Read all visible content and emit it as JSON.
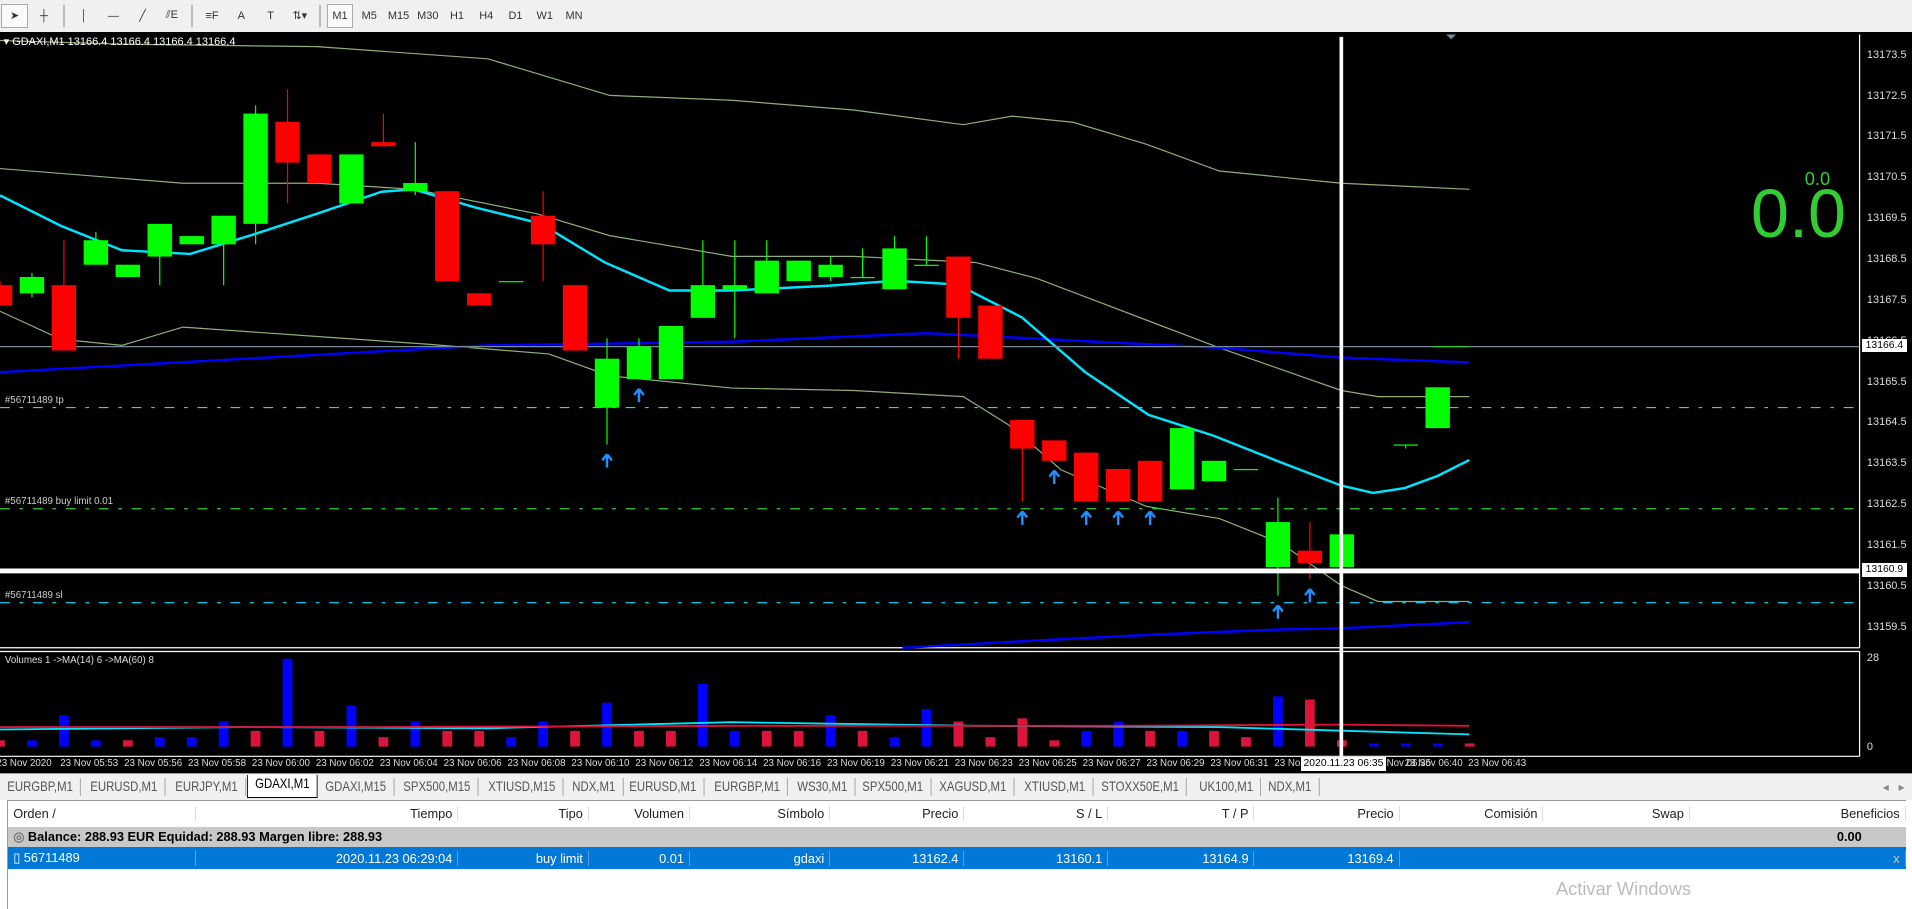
{
  "toolbar": {
    "tools": [
      "cursor",
      "crosshair",
      "vertical-line",
      "horizontal-line",
      "trendline",
      "equidistant-channel",
      "fibonacci",
      "text",
      "text-label",
      "arrows"
    ],
    "tool_glyphs": {
      "cursor": "➤",
      "crosshair": "┼",
      "vertical-line": "│",
      "horizontal-line": "—",
      "trendline": "╱",
      "equidistant-channel": "⫽E",
      "fibonacci": "≡F",
      "text": "A",
      "text-label": "T",
      "arrows": "⇅▾"
    },
    "periods": [
      "M1",
      "M5",
      "M15",
      "M30",
      "H1",
      "H4",
      "D1",
      "W1",
      "MN"
    ],
    "active_period": "M1"
  },
  "chart": {
    "header": "GDAXI,M1  13166.4 13166.4 13166.4 13166.4",
    "price_ticks": [
      "13173.5",
      "13172.5",
      "13171.5",
      "13170.5",
      "13169.5",
      "13168.5",
      "13167.5",
      "13166.5",
      "13165.5",
      "13164.5",
      "13163.5",
      "13162.5",
      "13161.5",
      "13160.5",
      "13159.5"
    ],
    "bid_label": "13166.4",
    "crosshair_price": "13160.9",
    "crosshair_time": "2020.11.23 06:35",
    "profit_small": "0.0",
    "profit_big": "0.0",
    "order_lines": {
      "tp": "#56711489 tp",
      "entry": "#56711489 buy limit 0.01",
      "sl": "#56711489 sl"
    },
    "order_prices": {
      "tp": 13164.9,
      "entry": 13162.4,
      "sl": 13160.1
    },
    "colors": {
      "up": "#00ff00",
      "down": "#ff0000",
      "ma": "#00e5ff",
      "vol_up": "#0000ff",
      "vol_down": "#dc143c"
    },
    "candles": [
      [
        13167.9,
        13168.0,
        13167.4,
        13167.4
      ],
      [
        13167.7,
        13168.2,
        13167.6,
        13168.1
      ],
      [
        13167.9,
        13169.0,
        13166.3,
        13166.3
      ],
      [
        13168.4,
        13169.2,
        13168.4,
        13169.0
      ],
      [
        13168.1,
        13168.4,
        13168.1,
        13168.4
      ],
      [
        13168.6,
        13169.4,
        13167.9,
        13169.4
      ],
      [
        13168.9,
        13169.1,
        13168.9,
        13169.1
      ],
      [
        13168.9,
        13169.6,
        13167.9,
        13169.6
      ],
      [
        13169.4,
        13172.3,
        13168.9,
        13172.1
      ],
      [
        13171.9,
        13172.7,
        13169.9,
        13170.9
      ],
      [
        13171.1,
        13171.1,
        13170.4,
        13170.4
      ],
      [
        13169.9,
        13171.1,
        13169.9,
        13171.1
      ],
      [
        13171.4,
        13172.1,
        13171.3,
        13171.3
      ],
      [
        13170.2,
        13171.4,
        13170.1,
        13170.4
      ],
      [
        13170.2,
        13170.2,
        13168.0,
        13168.0
      ],
      [
        13167.7,
        13167.7,
        13167.4,
        13167.4
      ],
      [
        13168.0,
        13168.0,
        13168.0,
        13168.0
      ],
      [
        13169.6,
        13170.2,
        13168.0,
        13168.9
      ],
      [
        13167.9,
        13167.9,
        13166.3,
        13166.3
      ],
      [
        13164.9,
        13166.6,
        13164.0,
        13166.1
      ],
      [
        13165.6,
        13166.6,
        13165.6,
        13166.4
      ],
      [
        13165.6,
        13166.9,
        13165.6,
        13166.9
      ],
      [
        13167.1,
        13169.0,
        13167.1,
        13167.9
      ],
      [
        13167.8,
        13169.0,
        13166.6,
        13167.9
      ],
      [
        13167.7,
        13169.0,
        13167.7,
        13168.5
      ],
      [
        13168.0,
        13168.5,
        13168.0,
        13168.5
      ],
      [
        13168.1,
        13168.6,
        13168.0,
        13168.4
      ],
      [
        13168.1,
        13168.8,
        13168.1,
        13168.1
      ],
      [
        13167.8,
        13169.1,
        13167.8,
        13168.8
      ],
      [
        13168.4,
        13169.1,
        13168.4,
        13168.4
      ],
      [
        13168.6,
        13168.6,
        13166.1,
        13167.1
      ],
      [
        13167.4,
        13167.4,
        13166.1,
        13166.1
      ],
      [
        13164.6,
        13164.6,
        13162.6,
        13163.9
      ],
      [
        13164.1,
        13164.1,
        13163.6,
        13163.6
      ],
      [
        13163.8,
        13163.8,
        13162.6,
        13162.6
      ],
      [
        13163.4,
        13163.4,
        13162.6,
        13162.6
      ],
      [
        13163.6,
        13163.6,
        13162.6,
        13162.6
      ],
      [
        13162.9,
        13164.4,
        13162.9,
        13164.4
      ],
      [
        13163.1,
        13163.6,
        13163.1,
        13163.6
      ],
      [
        13163.4,
        13163.4,
        13163.4,
        13163.4
      ],
      [
        13161.0,
        13162.7,
        13160.3,
        13162.1
      ],
      [
        13161.4,
        13162.1,
        13160.7,
        13161.1
      ],
      [
        13161.0,
        13161.8,
        13161.0,
        13161.8
      ],
      null,
      [
        13164.0,
        13164.0,
        13163.9,
        13164.0
      ],
      [
        13164.4,
        13165.4,
        13164.4,
        13165.4
      ]
    ],
    "buy_arrows": [
      19,
      20,
      32,
      33,
      34,
      35,
      36,
      40,
      41
    ],
    "volume_label": "Volumes 1  ->MA(14) 6  ->MA(60) 8",
    "volume_ticks": [
      "28",
      "0"
    ],
    "volumes": [
      2,
      2,
      10,
      2,
      2,
      3,
      3,
      8,
      5,
      28,
      5,
      13,
      3,
      8,
      5,
      5,
      3,
      8,
      5,
      14,
      5,
      5,
      20,
      5,
      5,
      5,
      10,
      5,
      3,
      12,
      8,
      3,
      9,
      2,
      5,
      8,
      5,
      5,
      5,
      3,
      16,
      15,
      2,
      1,
      1,
      1,
      1
    ],
    "volume_up": [
      0,
      1,
      1,
      1,
      0,
      1,
      1,
      1,
      0,
      1,
      0,
      1,
      0,
      1,
      0,
      0,
      1,
      1,
      0,
      1,
      0,
      0,
      1,
      1,
      0,
      0,
      1,
      0,
      1,
      1,
      0,
      0,
      0,
      0,
      1,
      1,
      0,
      1,
      0,
      0,
      1,
      0,
      0,
      1,
      1,
      1,
      0
    ],
    "time_labels": [
      "23 Nov 2020",
      "23 Nov 05:53",
      "23 Nov 05:56",
      "23 Nov 05:58",
      "23 Nov 06:00",
      "23 Nov 06:02",
      "23 Nov 06:04",
      "23 Nov 06:06",
      "23 Nov 06:08",
      "23 Nov 06:10",
      "23 Nov 06:12",
      "23 Nov 06:14",
      "23 Nov 06:16",
      "23 Nov 06:19",
      "23 Nov 06:21",
      "23 Nov 06:23",
      "23 Nov 06:25",
      "23 Nov 06:27",
      "23 Nov 06:29",
      "23 Nov 06:31",
      "23 No",
      "23 Nov 06:35",
      "23 Nov 06:40",
      "23 Nov 06:43"
    ]
  },
  "tabs": {
    "items": [
      "EURGBP,M1",
      "EURUSD,M1",
      "EURJPY,M1",
      "GDAXI,M1",
      "GDAXI,M15",
      "SPX500,M15",
      "XTIUSD,M15",
      "NDX,M1",
      "EURUSD,M1",
      "EURGBP,M1",
      "WS30,M1",
      "SPX500,M1",
      "XAGUSD,M1",
      "XTIUSD,M1",
      "STOXX50E,M1",
      "UK100,M1",
      "NDX,M1"
    ],
    "active": 3,
    "scroll_left": "◂",
    "scroll_right": "▸"
  },
  "terminal": {
    "columns": [
      "Orden  /",
      "Tiempo",
      "Tipo",
      "Volumen",
      "Símbolo",
      "Precio",
      "S / L",
      "T / P",
      "Precio",
      "Comisión",
      "Swap",
      "Beneficios"
    ],
    "balance": "Balance: 288.93 EUR  Equidad: 288.93  Margen libre: 288.93",
    "balance_profit": "0.00",
    "order": [
      "56711489",
      "2020.11.23 06:29:04",
      "buy limit",
      "0.01",
      "gdaxi",
      "13162.4",
      "13160.1",
      "13164.9",
      "13169.4",
      "",
      "",
      ""
    ],
    "close_glyph": "x"
  },
  "watermark": "Activar Windows"
}
